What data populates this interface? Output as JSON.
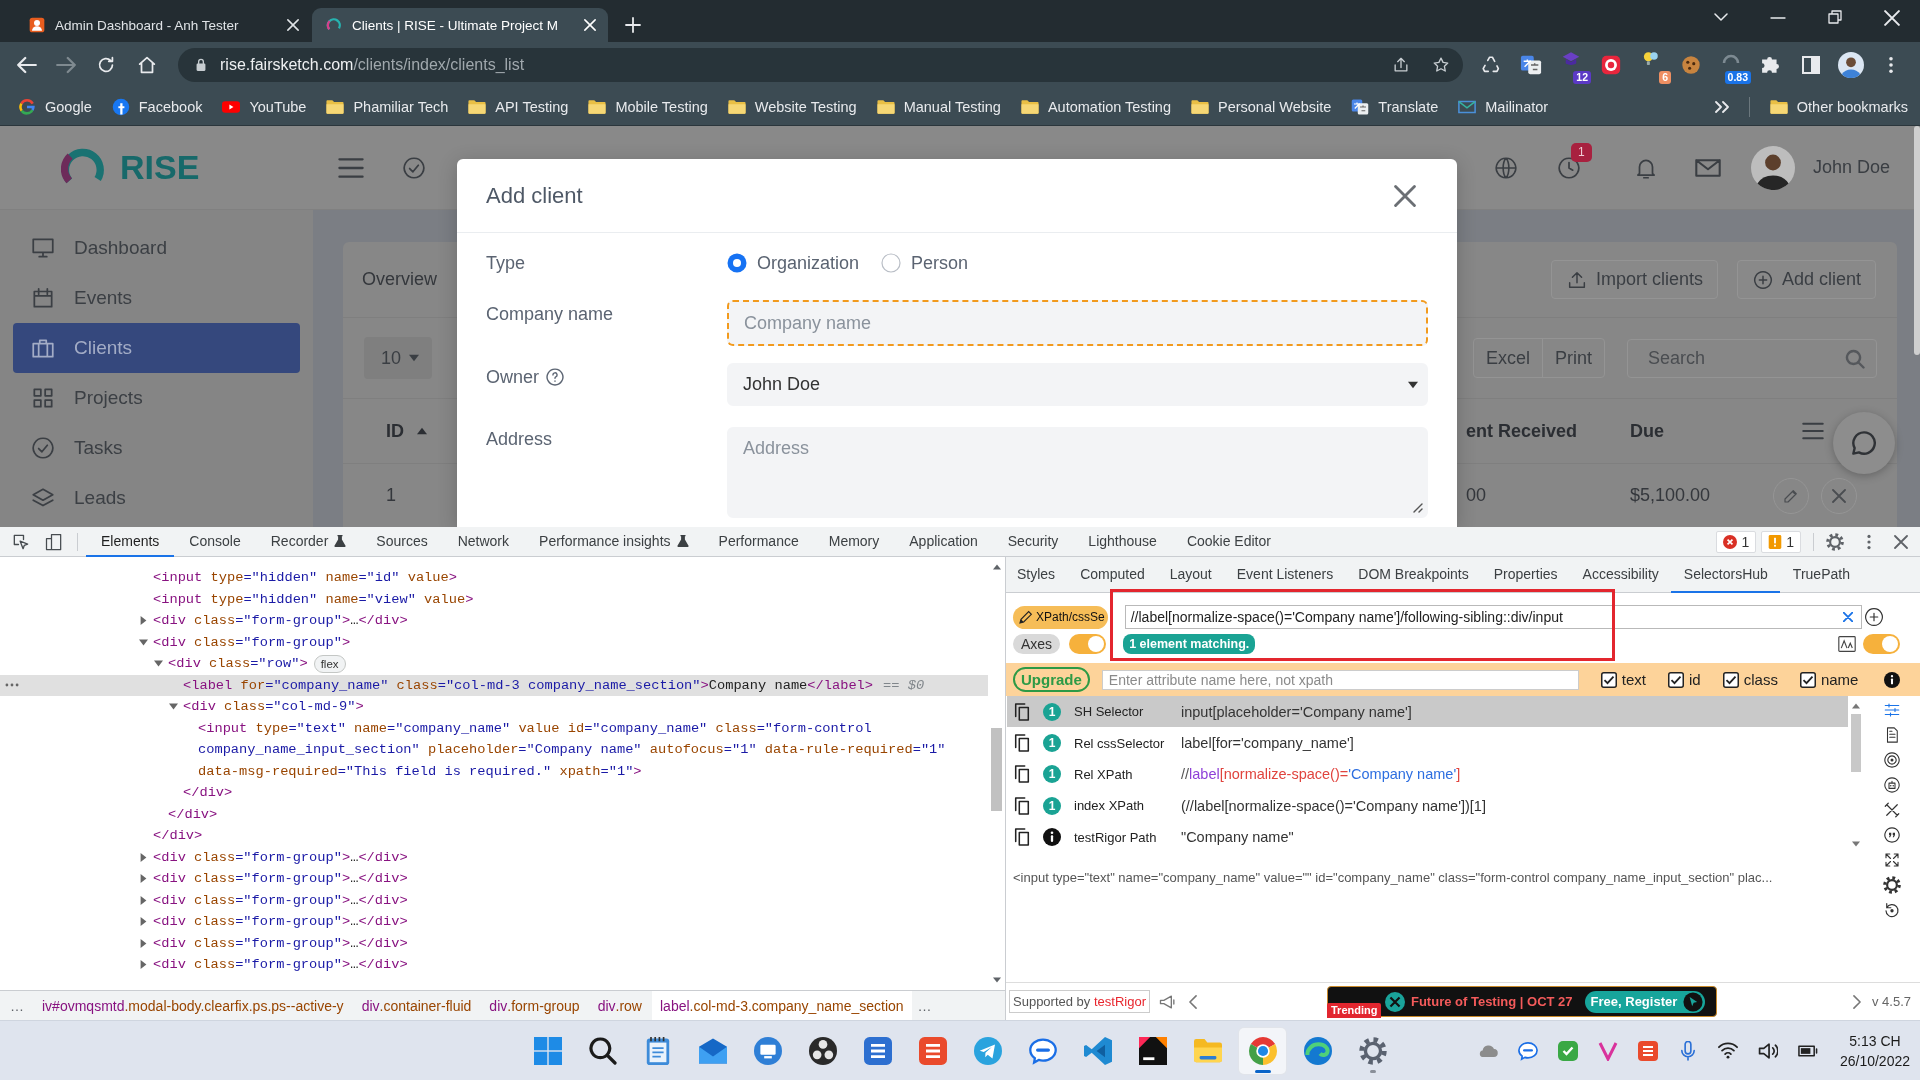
{
  "browser": {
    "tabs": [
      {
        "title": "Admin Dashboard - Anh Tester",
        "selected": false,
        "kind": "mascot"
      },
      {
        "title": "Clients | RISE - Ultimate Project M",
        "selected": true,
        "kind": "ring"
      }
    ],
    "address": {
      "host": "rise.fairsketch.com",
      "path": "/clients/index/clients_list"
    },
    "extensions": [
      {
        "kind": "recycle"
      },
      {
        "kind": "translate"
      },
      {
        "kind": "cap",
        "badge": "12"
      },
      {
        "kind": "record"
      },
      {
        "kind": "bulbs",
        "badge": "6"
      },
      {
        "kind": "cookie"
      },
      {
        "kind": "gauge",
        "badge": "0.83"
      }
    ],
    "bookmarks": [
      {
        "label": "Google",
        "kind": "google"
      },
      {
        "label": "Facebook",
        "kind": "facebook"
      },
      {
        "label": "YouTube",
        "kind": "youtube"
      },
      {
        "label": "Phamiliar Tech",
        "kind": "folder"
      },
      {
        "label": "API Testing",
        "kind": "folder"
      },
      {
        "label": "Mobile Testing",
        "kind": "folder"
      },
      {
        "label": "Website Testing",
        "kind": "folder"
      },
      {
        "label": "Manual Testing",
        "kind": "folder"
      },
      {
        "label": "Automation Testing",
        "kind": "folder"
      },
      {
        "label": "Personal Website",
        "kind": "folder"
      },
      {
        "label": "Translate",
        "kind": "translate"
      },
      {
        "label": "Mailinator",
        "kind": "inbox"
      }
    ],
    "other_bookmarks": "Other bookmarks"
  },
  "app": {
    "logo": "RISE",
    "header": {
      "badge": "1",
      "user": "John Doe"
    },
    "sidebar": [
      {
        "label": "Dashboard",
        "kind": "monitor",
        "selected": false
      },
      {
        "label": "Events",
        "kind": "calendar",
        "selected": false
      },
      {
        "label": "Clients",
        "kind": "briefcase",
        "selected": true
      },
      {
        "label": "Projects",
        "kind": "grid",
        "selected": false
      },
      {
        "label": "Tasks",
        "kind": "check",
        "selected": false
      },
      {
        "label": "Leads",
        "kind": "layers",
        "selected": false
      }
    ],
    "tab": "Overview",
    "actions": [
      {
        "label": "Import clients",
        "kind": "upload"
      },
      {
        "label": "Add client",
        "kind": "add"
      }
    ],
    "page_size": "10",
    "exports": [
      "Excel",
      "Print"
    ],
    "search": {
      "placeholder": "Search"
    },
    "columns": [
      {
        "label": "ID",
        "sorted": true
      },
      {
        "label": "ent Received",
        "sorted": false
      },
      {
        "label": "Due",
        "sorted": false
      }
    ],
    "row": [
      "1",
      "00",
      "$5,100.00"
    ]
  },
  "modal": {
    "title": "Add client",
    "type": {
      "label": "Type",
      "options": [
        {
          "label": "Organization",
          "selected": true
        },
        {
          "label": "Person",
          "selected": false
        }
      ]
    },
    "fields": [
      {
        "label": "Company name",
        "kind": "text",
        "placeholder": "Company name",
        "highlighted": true,
        "help": false
      },
      {
        "label": "Owner",
        "kind": "select",
        "value": "John Doe",
        "highlighted": false,
        "help": true
      },
      {
        "label": "Address",
        "kind": "textarea",
        "placeholder": "Address",
        "highlighted": false,
        "help": false
      }
    ]
  },
  "devtools": {
    "tabs": [
      {
        "label": "Elements",
        "selected": true,
        "experimental": false
      },
      {
        "label": "Console",
        "selected": false,
        "experimental": false
      },
      {
        "label": "Recorder",
        "selected": false,
        "experimental": true
      },
      {
        "label": "Sources",
        "selected": false,
        "experimental": false
      },
      {
        "label": "Network",
        "selected": false,
        "experimental": false
      },
      {
        "label": "Performance insights",
        "selected": false,
        "experimental": true
      },
      {
        "label": "Performance",
        "selected": false,
        "experimental": false
      },
      {
        "label": "Memory",
        "selected": false,
        "experimental": false
      },
      {
        "label": "Application",
        "selected": false,
        "experimental": false
      },
      {
        "label": "Security",
        "selected": false,
        "experimental": false
      },
      {
        "label": "Lighthouse",
        "selected": false,
        "experimental": false
      },
      {
        "label": "Cookie Editor",
        "selected": false,
        "experimental": false
      }
    ],
    "errors": "1",
    "warnings": "1",
    "dom_tree": [
      {
        "text": "<input type=\"hidden\" name=\"id\" value>",
        "selected": false
      },
      {
        "text": "<input type=\"hidden\" name=\"view\" value>",
        "selected": false
      },
      {
        "text": "<div class=\"form-group\">…</div>",
        "expanded": false,
        "selected": false
      },
      {
        "text": "<div class=\"form-group\">",
        "expanded": true,
        "selected": false,
        "closing": "</div>",
        "children": [
          {
            "text": "<div class=\"row\">",
            "badge": "flex",
            "expanded": true,
            "selected": false,
            "closing": "</div>",
            "children": [
              {
                "text": "<label for=\"company_name\" class=\"col-md-3 company_name_section\">Company name</label>",
                "suffix": "== $0",
                "selected": true
              },
              {
                "text": "<div class=\"col-md-9\">",
                "expanded": true,
                "selected": false,
                "closing": "</div>",
                "children": [
                  {
                    "text": "<input type=\"text\" name=\"company_name\" value id=\"company_name\" class=\"form-control company_name_input_section\" placeholder=\"Company name\" autofocus=\"1\" data-rule-required=\"1\" data-msg-required=\"This field is required.\" xpath=\"1\">",
                    "selected": false
                  }
                ]
              }
            ]
          }
        ]
      },
      {
        "text": "<div class=\"form-group\">…</div>",
        "expanded": false,
        "selected": false
      },
      {
        "text": "<div class=\"form-group\">…</div>",
        "expanded": false,
        "selected": false
      },
      {
        "text": "<div class=\"form-group\">…</div>",
        "expanded": false,
        "selected": false
      },
      {
        "text": "<div class=\"form-group\">…</div>",
        "expanded": false,
        "selected": false
      },
      {
        "text": "<div class=\"form-group\">…</div>",
        "expanded": false,
        "selected": false
      },
      {
        "text": "<div class=\"form-group\">…</div>",
        "expanded": false,
        "selected": false
      }
    ],
    "breadcrumbs": [
      {
        "label": "iv#ovmqsmtd.modal-body.clearfix.ps.ps--active-y",
        "selected": false
      },
      {
        "label": "div.container-fluid",
        "selected": false
      },
      {
        "label": "div.form-group",
        "selected": false
      },
      {
        "label": "div.row",
        "selected": false
      },
      {
        "label": "label.col-md-3.company_name_section",
        "selected": true
      }
    ],
    "crumb_more": [
      "…",
      "…"
    ],
    "panes": [
      {
        "label": "Styles",
        "selected": false
      },
      {
        "label": "Computed",
        "selected": false
      },
      {
        "label": "Layout",
        "selected": false
      },
      {
        "label": "Event Listeners",
        "selected": false
      },
      {
        "label": "DOM Breakpoints",
        "selected": false
      },
      {
        "label": "Properties",
        "selected": false
      },
      {
        "label": "Accessibility",
        "selected": false
      },
      {
        "label": "SelectorsHub",
        "selected": true
      },
      {
        "label": "TruePath",
        "selected": false
      }
    ],
    "selectorshub": {
      "mode": "XPath/cssSe",
      "query": "//label[normalize-space()='Company name']/following-sibling::div/input",
      "match": "1 element matching.",
      "axes": {
        "label": "Axes",
        "on": true
      },
      "case_toggle": {
        "on": true
      },
      "upgrade": "Upgrade",
      "attribute_field": {
        "placeholder": "Enter attribute name here, not xpath"
      },
      "attributes": [
        {
          "label": "text",
          "checked": true
        },
        {
          "label": "id",
          "checked": true
        },
        {
          "label": "class",
          "checked": true
        },
        {
          "label": "name",
          "checked": true
        }
      ],
      "results": [
        {
          "kind": "count",
          "count": "1",
          "label": "SH Selector",
          "selected": true,
          "value": [
            {
              "kind": "plain",
              "text": "input[placeholder='Company name']"
            }
          ]
        },
        {
          "kind": "count",
          "count": "1",
          "label": "Rel cssSelector",
          "selected": false,
          "value": [
            {
              "kind": "plain",
              "text": "label[for='company_name']"
            }
          ]
        },
        {
          "kind": "count",
          "count": "1",
          "label": "Rel XPath",
          "selected": false,
          "value": [
            {
              "kind": "axis",
              "text": "//"
            },
            {
              "kind": "tag",
              "text": "label"
            },
            {
              "kind": "predicate",
              "text": "[normalize-space()="
            },
            {
              "kind": "string",
              "text": "'Company name'"
            },
            {
              "kind": "predicate",
              "text": "]"
            }
          ]
        },
        {
          "kind": "count",
          "count": "1",
          "label": "index XPath",
          "selected": false,
          "value": [
            {
              "kind": "plain",
              "text": "(//label[normalize-space()='Company name'])[1]"
            }
          ]
        },
        {
          "kind": "info",
          "label": "testRigor Path",
          "selected": false,
          "value": [
            {
              "kind": "plain",
              "text": "\"Company name\""
            }
          ]
        }
      ],
      "output": "<input type=\"text\" name=\"company_name\" value=\"\" id=\"company_name\" class=\"form-control company_name_input_section\" plac...",
      "supported": {
        "text": "Supported by",
        "link": "testRigor"
      },
      "banner": {
        "tag": "Trending",
        "text": "Future of Testing | OCT 27",
        "action": "Free, Register"
      },
      "version": "v 4.5.7"
    }
  },
  "taskbar": {
    "apps": [
      {
        "kind": "start",
        "selected": false,
        "running": false
      },
      {
        "kind": "search",
        "selected": false,
        "running": false
      },
      {
        "kind": "notes",
        "selected": false,
        "running": false
      },
      {
        "kind": "mail",
        "selected": false,
        "running": false
      },
      {
        "kind": "remote",
        "selected": false,
        "running": false
      },
      {
        "kind": "aperture",
        "selected": false,
        "running": false
      },
      {
        "kind": "sblue",
        "selected": false,
        "running": false
      },
      {
        "kind": "sred",
        "selected": false,
        "running": false
      },
      {
        "kind": "send",
        "selected": false,
        "running": false
      },
      {
        "kind": "zalo",
        "selected": false,
        "running": false
      },
      {
        "kind": "code",
        "selected": false,
        "running": false
      },
      {
        "kind": "ide",
        "selected": false,
        "running": false
      },
      {
        "kind": "files",
        "selected": false,
        "running": false
      },
      {
        "kind": "chrome",
        "selected": true,
        "running": true
      },
      {
        "kind": "edge",
        "selected": false,
        "running": false
      },
      {
        "kind": "settings",
        "selected": false,
        "running": true
      }
    ],
    "tray": [
      {
        "kind": "cloud"
      },
      {
        "kind": "zalo"
      },
      {
        "kind": "shield"
      },
      {
        "kind": "vmark"
      },
      {
        "kind": "sred"
      },
      {
        "kind": "mic"
      },
      {
        "kind": "wifi"
      },
      {
        "kind": "volume"
      },
      {
        "kind": "battery"
      }
    ],
    "time": "5:13 CH",
    "date": "26/10/2022"
  }
}
